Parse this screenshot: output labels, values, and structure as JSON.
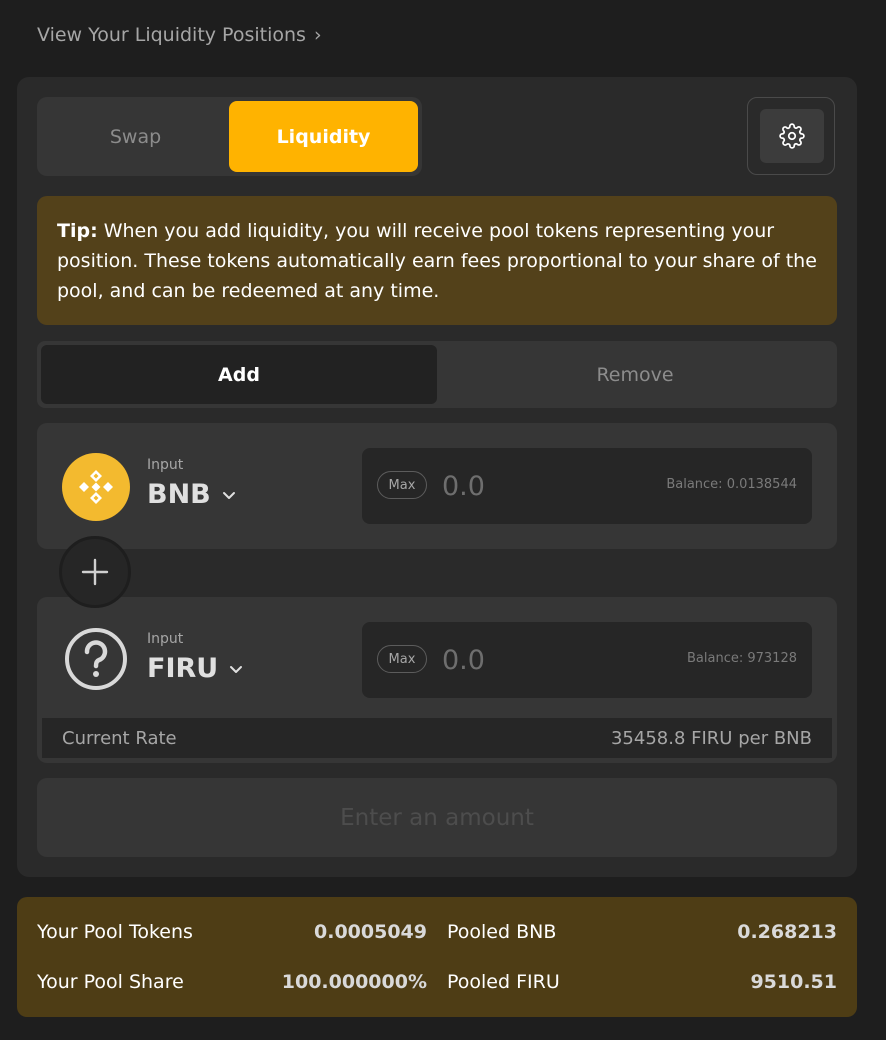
{
  "nav": {
    "positions_link": "View Your Liquidity Positions",
    "chevron": "›"
  },
  "tabs": {
    "swap": "Swap",
    "liquidity": "Liquidity"
  },
  "settings": {
    "icon": "gear-icon"
  },
  "tip": {
    "label": "Tip:",
    "text": " When you add liquidity, you will receive pool tokens representing your position. These tokens automatically earn fees proportional to your share of the pool, and can be redeemed at any time."
  },
  "mode": {
    "add": "Add",
    "remove": "Remove"
  },
  "token_a": {
    "input_label": "Input",
    "symbol": "BNB",
    "max_label": "Max",
    "placeholder": "0.0",
    "value": "",
    "balance": "Balance: 0.0138544"
  },
  "token_b": {
    "input_label": "Input",
    "symbol": "FIRU",
    "max_label": "Max",
    "placeholder": "0.0",
    "value": "",
    "balance": "Balance: 973128"
  },
  "rate": {
    "label": "Current Rate",
    "value": "35458.8 FIRU per BNB"
  },
  "action": {
    "label": "Enter an amount"
  },
  "pool": {
    "tokens_label": "Your Pool Tokens",
    "tokens_value": "0.0005049",
    "share_label": "Your Pool Share",
    "share_value": "100.000000%",
    "pooled_a_label": "Pooled BNB",
    "pooled_a_value": "0.268213",
    "pooled_b_label": "Pooled FIRU",
    "pooled_b_value": "9510.51"
  },
  "colors": {
    "accent": "#ffb300",
    "bnb": "#f3ba2f",
    "tip_bg": "#53411a",
    "pool_bg": "#4e3d15"
  }
}
